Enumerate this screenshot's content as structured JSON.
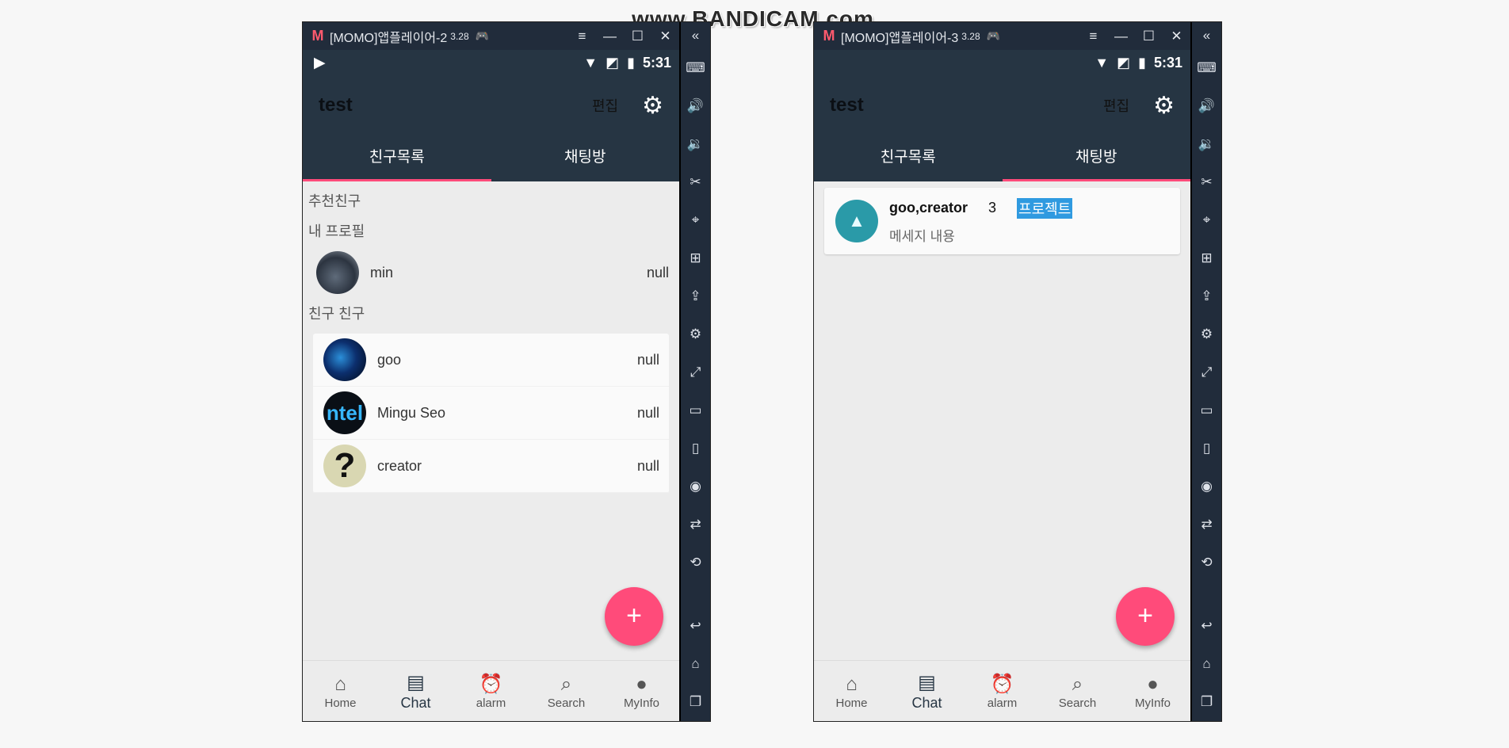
{
  "watermark": "www.BANDICAM.com",
  "windows": [
    {
      "title": "[MOMO]앱플레이어-2",
      "version": "3.28",
      "statusbar": {
        "time": "5:31"
      },
      "app": {
        "title": "test",
        "edit_label": "편집",
        "tabs": [
          "친구목록",
          "채팅방"
        ],
        "active_tab": 0
      },
      "friends": {
        "recommended_label": "추천친구",
        "my_profile_label": "내 프로필",
        "me": {
          "name": "min",
          "status": "null"
        },
        "friends_label": "친구   친구",
        "list": [
          {
            "name": "goo",
            "status": "null"
          },
          {
            "name": "Mingu Seo",
            "status": "null",
            "avatar_text": "ntel"
          },
          {
            "name": "creator",
            "status": "null",
            "avatar_text": "?"
          }
        ]
      },
      "nav": [
        {
          "label": "Home",
          "icon": "home-icon"
        },
        {
          "label": "Chat",
          "icon": "chat-icon"
        },
        {
          "label": "alarm",
          "icon": "alarm-icon"
        },
        {
          "label": "Search",
          "icon": "search-icon"
        },
        {
          "label": "MyInfo",
          "icon": "person-icon"
        }
      ],
      "fab": "+"
    },
    {
      "title": "[MOMO]앱플레이어-3",
      "version": "3.28",
      "statusbar": {
        "time": "5:31"
      },
      "app": {
        "title": "test",
        "edit_label": "편집",
        "tabs": [
          "친구목록",
          "채팅방"
        ],
        "active_tab": 1
      },
      "chatroom": {
        "name": "goo,creator",
        "count": "3",
        "title": "프로젝트",
        "preview": "메세지 내용"
      },
      "nav": [
        {
          "label": "Home",
          "icon": "home-icon"
        },
        {
          "label": "Chat",
          "icon": "chat-icon"
        },
        {
          "label": "alarm",
          "icon": "alarm-icon"
        },
        {
          "label": "Search",
          "icon": "search-icon"
        },
        {
          "label": "MyInfo",
          "icon": "person-icon"
        }
      ],
      "fab": "+"
    }
  ],
  "colors": {
    "appbar": "#263543",
    "emulator_chrome": "#212c3b",
    "accent": "#ff4b7a",
    "title_highlight": "#2f9ae0"
  }
}
